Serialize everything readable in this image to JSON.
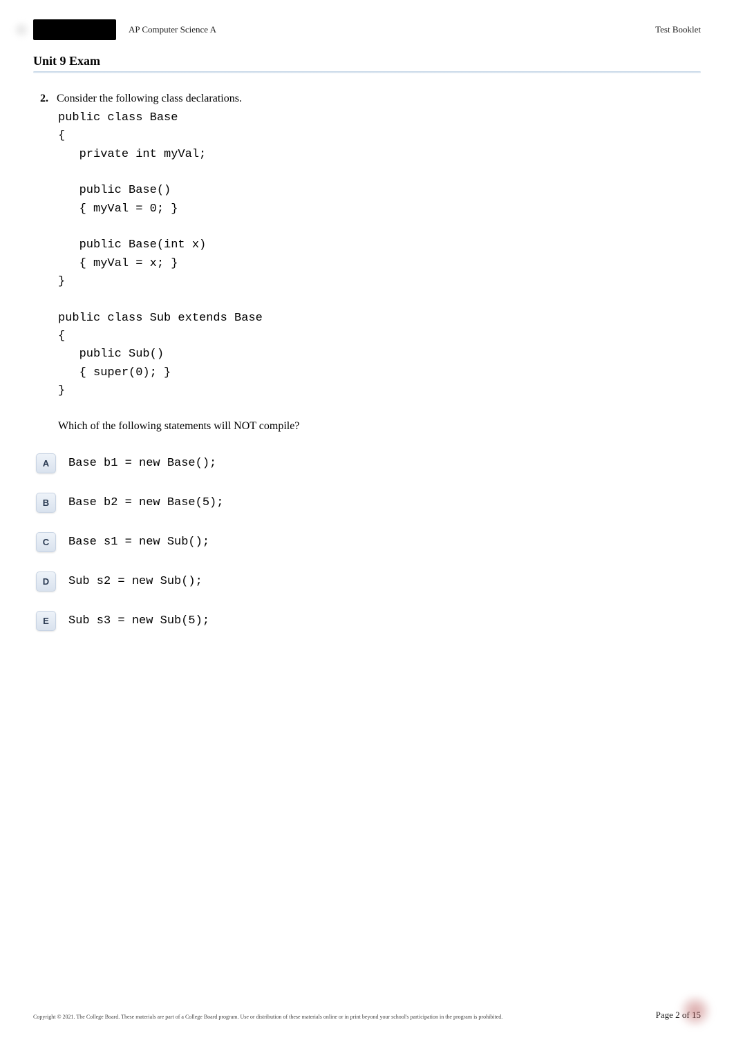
{
  "header": {
    "course": "AP Computer Science A",
    "bookletLabel": "Test Booklet"
  },
  "title": "Unit 9 Exam",
  "question": {
    "number": "2.",
    "intro": "Consider the following class declarations.",
    "code": "public class Base\n{\n   private int myVal;\n\n   public Base()\n   { myVal = 0; }\n\n   public Base(int x)\n   { myVal = x; }\n}\n\npublic class Sub extends Base\n{\n   public Sub()\n   { super(0); }\n}",
    "prompt": "Which of the following statements will NOT compile?",
    "answers": [
      {
        "letter": "A",
        "code": "Base b1 = new Base();"
      },
      {
        "letter": "B",
        "code": "Base b2 = new Base(5);"
      },
      {
        "letter": "C",
        "code": "Base s1 = new Sub();"
      },
      {
        "letter": "D",
        "code": "Sub s2 = new Sub();"
      },
      {
        "letter": "E",
        "code": "Sub s3 = new Sub(5);"
      }
    ]
  },
  "footer": {
    "copyright": "Copyright © 2021. The College Board. These materials are part of a College Board program. Use or distribution of these materials online or in print beyond your school's participation in the program is prohibited.",
    "page": "Page 2 of 15"
  }
}
